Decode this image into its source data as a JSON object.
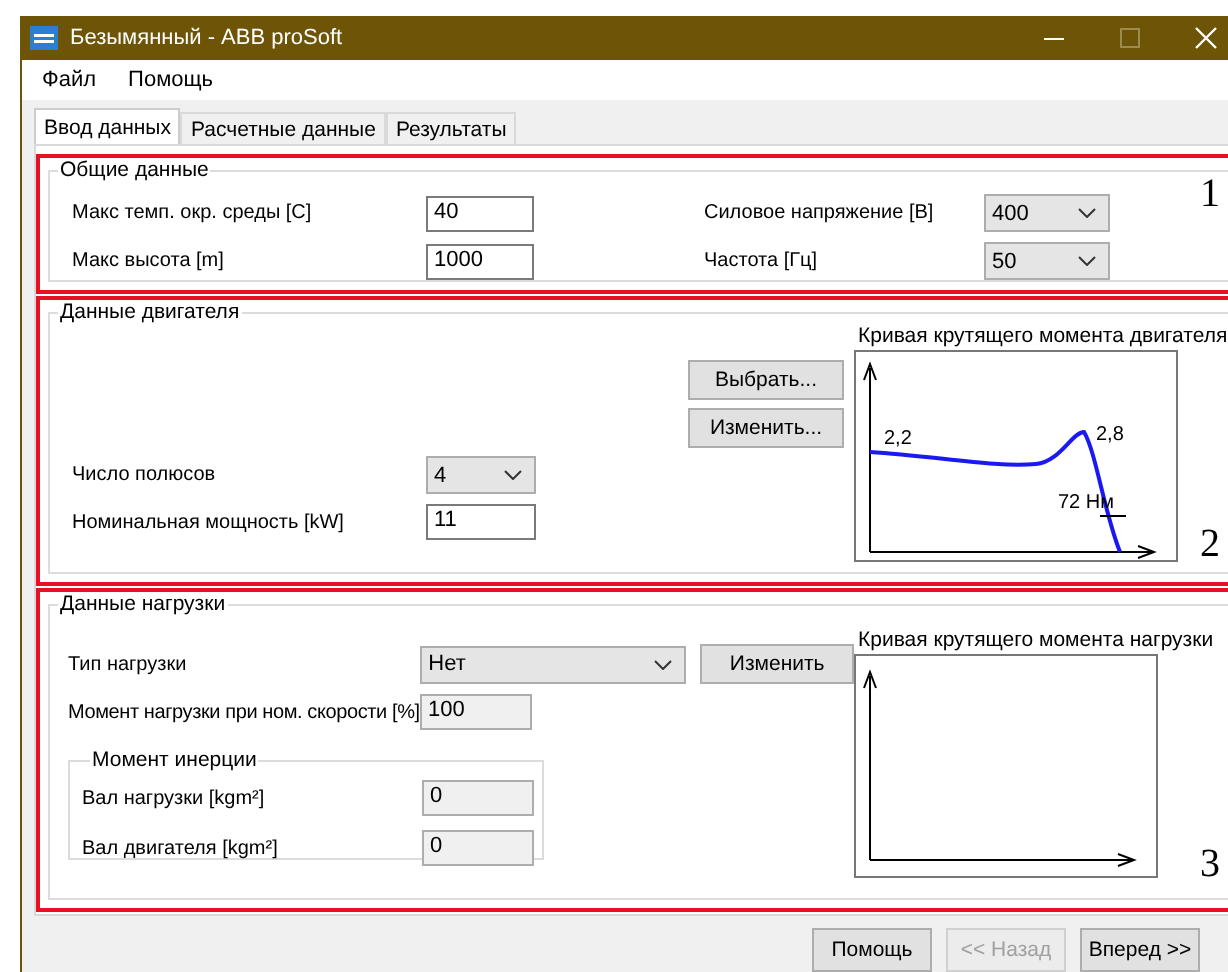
{
  "window": {
    "title": "Безымянный - ABB proSoft"
  },
  "menu": [
    "Файл",
    "Помощь"
  ],
  "tabs": [
    {
      "label": "Ввод данных",
      "selected": true
    },
    {
      "label": "Расчетные данные",
      "selected": false
    },
    {
      "label": "Результаты",
      "selected": false
    }
  ],
  "general": {
    "title": "Общие данные",
    "annotation": "1",
    "left": [
      {
        "label": "Макс темп. окр. среды [C]",
        "value": "40"
      },
      {
        "label": "Макс высота [m]",
        "value": "1000"
      }
    ],
    "right": [
      {
        "label": "Силовое напряжение [В]",
        "value": "400"
      },
      {
        "label": "Частота [Гц]",
        "value": "50"
      }
    ]
  },
  "motor": {
    "title": "Данные двигателя",
    "annotation": "2",
    "buttons": [
      "Выбрать...",
      "Изменить..."
    ],
    "fields": [
      {
        "kind": "combo",
        "label": "Число полюсов",
        "value": "4"
      },
      {
        "kind": "input",
        "label": "Номинальная мощность [kW]",
        "value": "11"
      }
    ],
    "chart": {
      "title": "Кривая крутящего момента двигателя",
      "labels": [
        "2,2",
        "2,8",
        "72 Нм"
      ]
    }
  },
  "load": {
    "title": "Данные нагрузки",
    "annotation": "3",
    "type": {
      "label": "Тип нагрузки",
      "value": "Нет"
    },
    "button": "Изменить",
    "torque": {
      "label": "Момент нагрузки при ном. скорости [%]",
      "value": "100",
      "disabled": true
    },
    "inertia": {
      "title": "Момент инерции",
      "fields": [
        {
          "label": "Вал нагрузки [kgm²]",
          "value": "0",
          "disabled": true
        },
        {
          "label": "Вал двигателя [kgm²]",
          "value": "0",
          "disabled": true
        }
      ]
    },
    "chart": {
      "title": "Кривая крутящего момента нагрузки"
    }
  },
  "footer": [
    {
      "label": "Помощь",
      "disabled": false
    },
    {
      "label": "<< Назад",
      "disabled": true
    },
    {
      "label": "Вперед >>",
      "disabled": false
    }
  ]
}
